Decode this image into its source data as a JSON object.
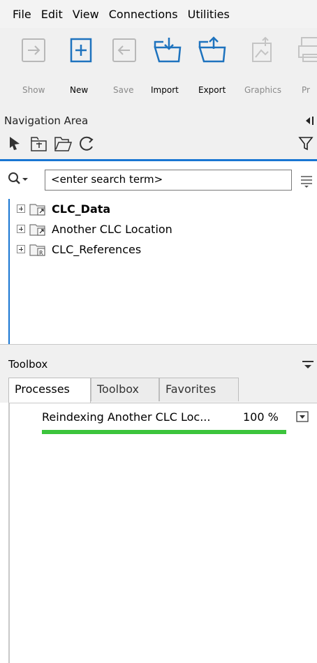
{
  "menu": [
    "File",
    "Edit",
    "View",
    "Connections",
    "Utilities"
  ],
  "toolbar": {
    "show_label": "Show",
    "new_label": "New",
    "save_label": "Save",
    "import_label": "Import",
    "export_label": "Export",
    "graphics_label": "Graphics",
    "print_label_partial": "Pr"
  },
  "navigation": {
    "title": "Navigation Area"
  },
  "search": {
    "placeholder": "<enter search term>"
  },
  "tree": [
    {
      "label": "CLC_Data",
      "bold": true,
      "icon": "folder-link-icon"
    },
    {
      "label": "Another CLC Location",
      "bold": false,
      "icon": "folder-link-icon"
    },
    {
      "label": "CLC_References",
      "bold": false,
      "icon": "folder-reference-icon"
    }
  ],
  "toolbox": {
    "title": "Toolbox",
    "tabs": [
      "Processes",
      "Toolbox",
      "Favorites"
    ],
    "active_tab": "Processes",
    "process": {
      "name": "Reindexing Another CLC Loc...",
      "percent_text": "100 %",
      "progress": 1.0
    }
  },
  "colors": {
    "accent": "#1976d2",
    "progress": "#3cc43c",
    "icon_blue": "#1e73be"
  }
}
